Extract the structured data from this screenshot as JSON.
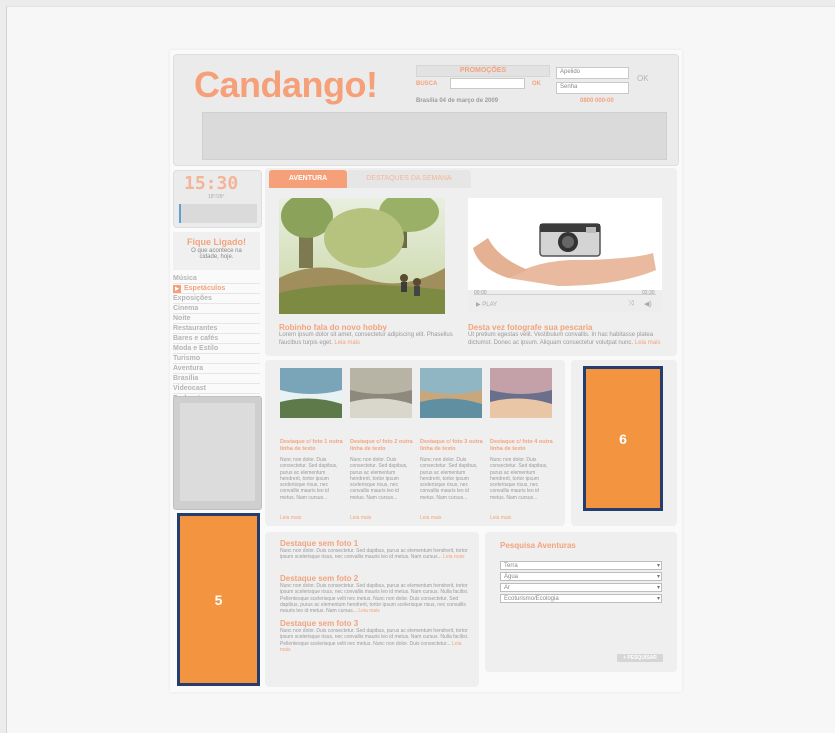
{
  "header": {
    "logo": "Candango!",
    "promo_label": "PROMOÇÕES",
    "search_label": "BUSCA",
    "search_ok": "OK",
    "date": "Brasília 04 de março de 2009",
    "phone": "0800 000-00",
    "login_user_placeholder": "Apelido",
    "login_pass_placeholder": "Senha",
    "login_ok": "OK"
  },
  "sidebar": {
    "clock": "15:30",
    "weather": "18°/28°",
    "fique_title": "Fique Ligado!",
    "fique_sub": "O que acontece na cidade, hoje.",
    "menu": [
      {
        "label": "Música"
      },
      {
        "label": "Espetáculos"
      },
      {
        "label": "Exposições"
      },
      {
        "label": "Cinema"
      },
      {
        "label": "Noite"
      },
      {
        "label": "Restaurantes"
      },
      {
        "label": "Bares e cafés"
      },
      {
        "label": "Moda e Estilo"
      },
      {
        "label": "Turismo"
      },
      {
        "label": "Aventura"
      },
      {
        "label": "Brasília"
      },
      {
        "label": "Videocast"
      },
      {
        "label": "Podcast"
      }
    ]
  },
  "tabs": {
    "active": "AVENTURA",
    "inactive": "DESTAQUES DA SEMANA"
  },
  "featured": [
    {
      "title": "Robinho fala do novo hobby",
      "text": "Lorem ipsum dolor sit amet, consectetur adipiscing elit. Phasellus faucibus turpis eget.",
      "more": "Leia mais"
    },
    {
      "title": "Desta vez fotografe sua pescaria",
      "text": "Ut pretium egestas velit. Vestibulum convallis. In hac habitasse platea dictumst. Donec ac ipsum. Aliquam consectetur volutpat nunc.",
      "more": "Leia mais"
    }
  ],
  "video": {
    "time_start": "00:00",
    "time_end": "02:30",
    "play": "PLAY"
  },
  "thumbs": [
    {
      "title": "Destaque c/ foto 1 outra linha de texto",
      "text": "Nunc non dolor. Duis consectetur. Sed dapibus, purus ac elementum hendrerit, tortor ipsum scelerisque risus, nec convallis mauris leo id metus. Nam cursus...",
      "more": "Leia mais"
    },
    {
      "title": "Destaque c/ foto 2 outra linha de texto",
      "text": "Nunc non dolor. Duis consectetur. Sed dapibus, purus ac elementum hendrerit, tortor ipsum scelerisque risus, nec convallis mauris leo id metus. Nam cursus...",
      "more": "Leia mais"
    },
    {
      "title": "Destaque c/ foto 3 outra linha de texto",
      "text": "Nunc non dolor. Duis consectetur. Sed dapibus, purus ac elementum hendrerit, tortor ipsum scelerisque risus, nec convallis mauris leo id metus. Nam cursus...",
      "more": "Leia mais"
    },
    {
      "title": "Destaque c/ foto 4 outra linha de texto",
      "text": "Nunc non dolor. Duis consectetur. Sed dapibus, purus ac elementum hendrerit, tortor ipsum scelerisque risus, nec convallis mauris leo id metus. Nam cursus...",
      "more": "Leia mais"
    }
  ],
  "no_photo": [
    {
      "title": "Destaque sem foto 1",
      "text": "Nunc non dolor. Duis consectetur. Sed dapibus, purus ac elementum hendrerit, tortor ipsum scelerisque risus, nec convallis mauris leo id metus. Nam cursus...",
      "more": "Leia mais"
    },
    {
      "title": "Destaque sem foto 2",
      "text": "Nunc non dolor. Duis consectetur. Sed dapibus, purus ac elementum hendrerit, tortor ipsum scelerisque risus, nec convallis mauris leo id metus. Nam cursus. Nulla facilisi. Pellentesque scelerisque velit nec metus. Nunc non dolor. Duis consectetur. Sed dapibus, purus ac elementum hendrerit, tortor ipsum scelerisque risus, nec convallis mauris leo id metus. Nam cursus...",
      "more": "Leia mais"
    },
    {
      "title": "Destaque sem foto 3",
      "text": "Nunc non dolor. Duis consectetur. Sed dapibus, purus ac elementum hendrerit, tortor ipsum scelerisque risus, nec convallis mauris leo id metus. Nam cursus. Nulla facilisi. Pellentesque scelerisque velit nec metus. Nunc non dolor. Duis consectetur...",
      "more": "Leia mais"
    }
  ],
  "search": {
    "title": "Pesquisa Aventuras",
    "options": [
      "Terra",
      "Água",
      "Ar",
      "Ecoturismo/Ecologia"
    ],
    "button": "PESQUISAR"
  },
  "markers": {
    "five": "5",
    "six": "6"
  },
  "colors": {
    "accent": "#f3a37c",
    "marker": "#f39440",
    "marker_border": "#243c6e"
  }
}
